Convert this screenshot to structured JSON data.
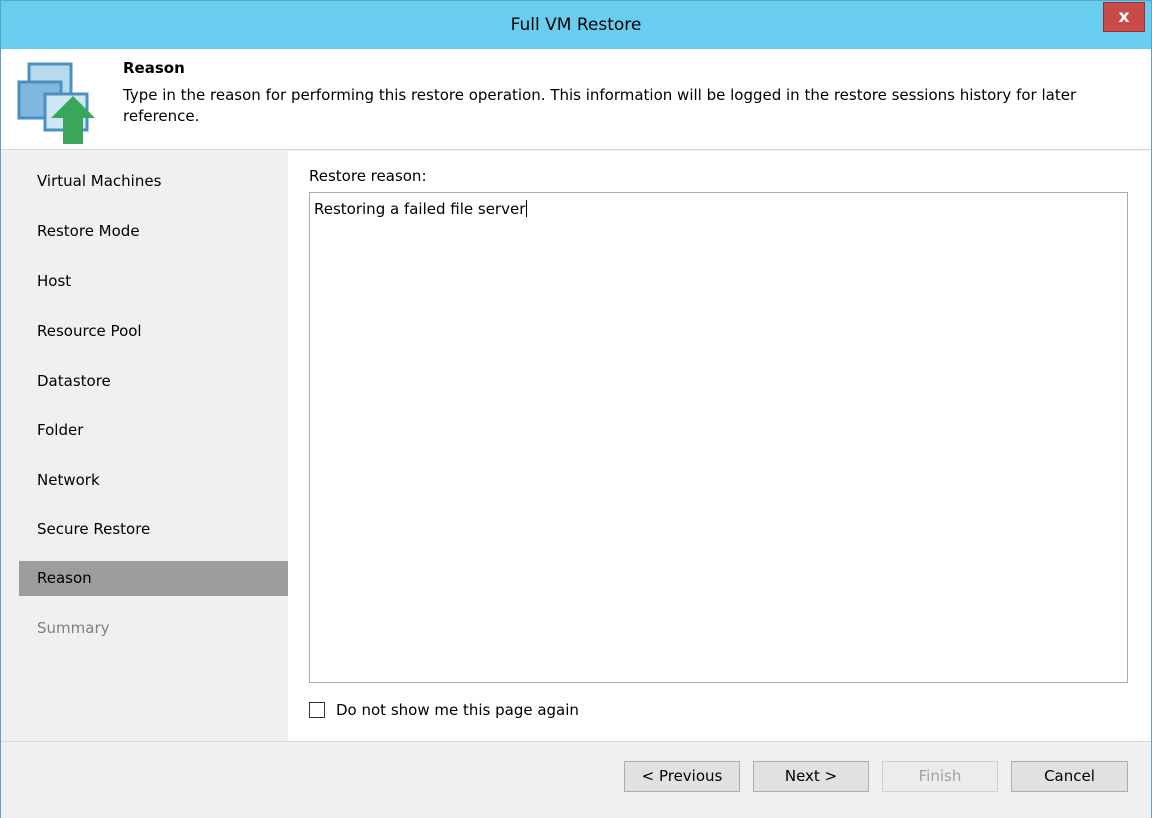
{
  "window": {
    "title": "Full VM Restore",
    "close_label": "x"
  },
  "header": {
    "title": "Reason",
    "description": "Type in the reason for performing this restore operation. This information will be logged in the restore sessions history for later reference.",
    "icon": "vm-restore-icon"
  },
  "nav": {
    "items": [
      {
        "label": "Virtual Machines",
        "state": "normal"
      },
      {
        "label": "Restore Mode",
        "state": "normal"
      },
      {
        "label": "Host",
        "state": "normal"
      },
      {
        "label": "Resource Pool",
        "state": "normal"
      },
      {
        "label": "Datastore",
        "state": "normal"
      },
      {
        "label": "Folder",
        "state": "normal"
      },
      {
        "label": "Network",
        "state": "normal"
      },
      {
        "label": "Secure Restore",
        "state": "normal"
      },
      {
        "label": "Reason",
        "state": "active"
      },
      {
        "label": "Summary",
        "state": "disabled"
      }
    ]
  },
  "main": {
    "reason_label": "Restore reason:",
    "reason_value": "Restoring a failed file server",
    "dont_show_label": "Do not show me this page again",
    "dont_show_checked": false
  },
  "footer": {
    "previous_label": "< Previous",
    "next_label": "Next >",
    "finish_label": "Finish",
    "cancel_label": "Cancel"
  },
  "colors": {
    "titlebar": "#68cdef",
    "close": "#c74b48",
    "nav_active": "#9d9d9d",
    "icon_arrow": "#3aa65a"
  }
}
